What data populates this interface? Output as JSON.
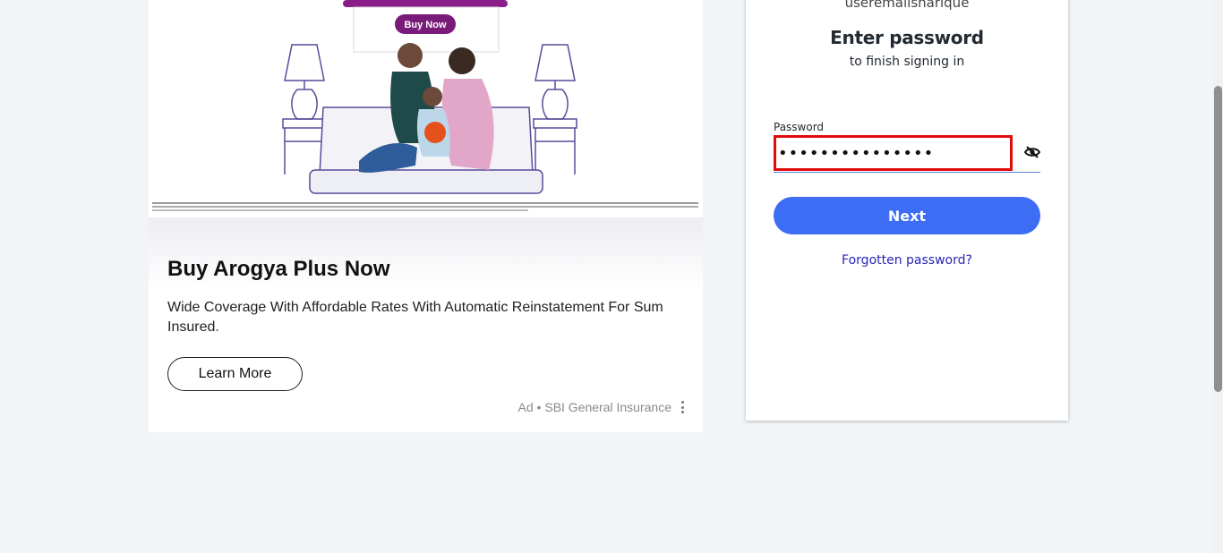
{
  "ad": {
    "image_button_label": "Buy Now",
    "title": "Buy Arogya Plus Now",
    "description": "Wide Coverage With Affordable Rates With Automatic Reinstatement For Sum Insured.",
    "cta_label": "Learn More",
    "footer": "Ad • SBI General Insurance",
    "menu_icon": "more-vertical-icon",
    "brand_color": "#7a1b7a"
  },
  "login": {
    "user_email": "useremailsharique",
    "heading": "Enter password",
    "subheading": "to finish signing in",
    "password_label": "Password",
    "password_value": "•••••••••••••••",
    "show_password_icon": "eye-slash-icon",
    "next_label": "Next",
    "forgot_label": "Forgotten password?",
    "accent_color": "#3d6cf5",
    "error_border_color": "#e00b0b",
    "link_color": "#2a24b8"
  }
}
